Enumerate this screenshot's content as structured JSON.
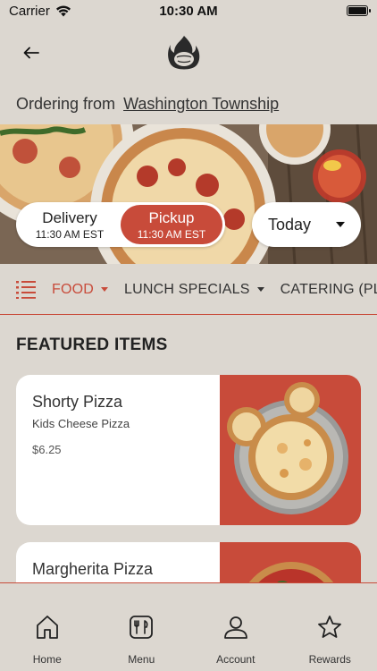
{
  "status_bar": {
    "carrier": "Carrier",
    "time": "10:30 AM",
    "battery_level": 1.0
  },
  "header": {
    "logo_alt": "OG Craic"
  },
  "ordering": {
    "prefix": "Ordering from",
    "location": "Washington Township"
  },
  "mode_toggle": {
    "delivery": {
      "label": "Delivery",
      "time": "11:30 AM EST"
    },
    "pickup": {
      "label": "Pickup",
      "time": "11:30 AM EST"
    },
    "selected": "pickup"
  },
  "day_select": {
    "value": "Today"
  },
  "categories": [
    {
      "label": "FOOD",
      "active": true
    },
    {
      "label": "LUNCH SPECIALS",
      "active": false
    },
    {
      "label": "CATERING (PLEA",
      "active": false
    }
  ],
  "featured": {
    "title": "FEATURED ITEMS",
    "items": [
      {
        "name": "Shorty Pizza",
        "description": "Kids Cheese Pizza",
        "price": "$6.25"
      },
      {
        "name": "Margherita Pizza",
        "description": "",
        "price": ""
      }
    ]
  },
  "tabs": [
    {
      "label": "Home",
      "icon": "home-icon"
    },
    {
      "label": "Menu",
      "icon": "menu-icon"
    },
    {
      "label": "Account",
      "icon": "account-icon"
    },
    {
      "label": "Rewards",
      "icon": "star-icon"
    }
  ],
  "colors": {
    "accent": "#c84b3a",
    "background": "#dcd7d0"
  }
}
